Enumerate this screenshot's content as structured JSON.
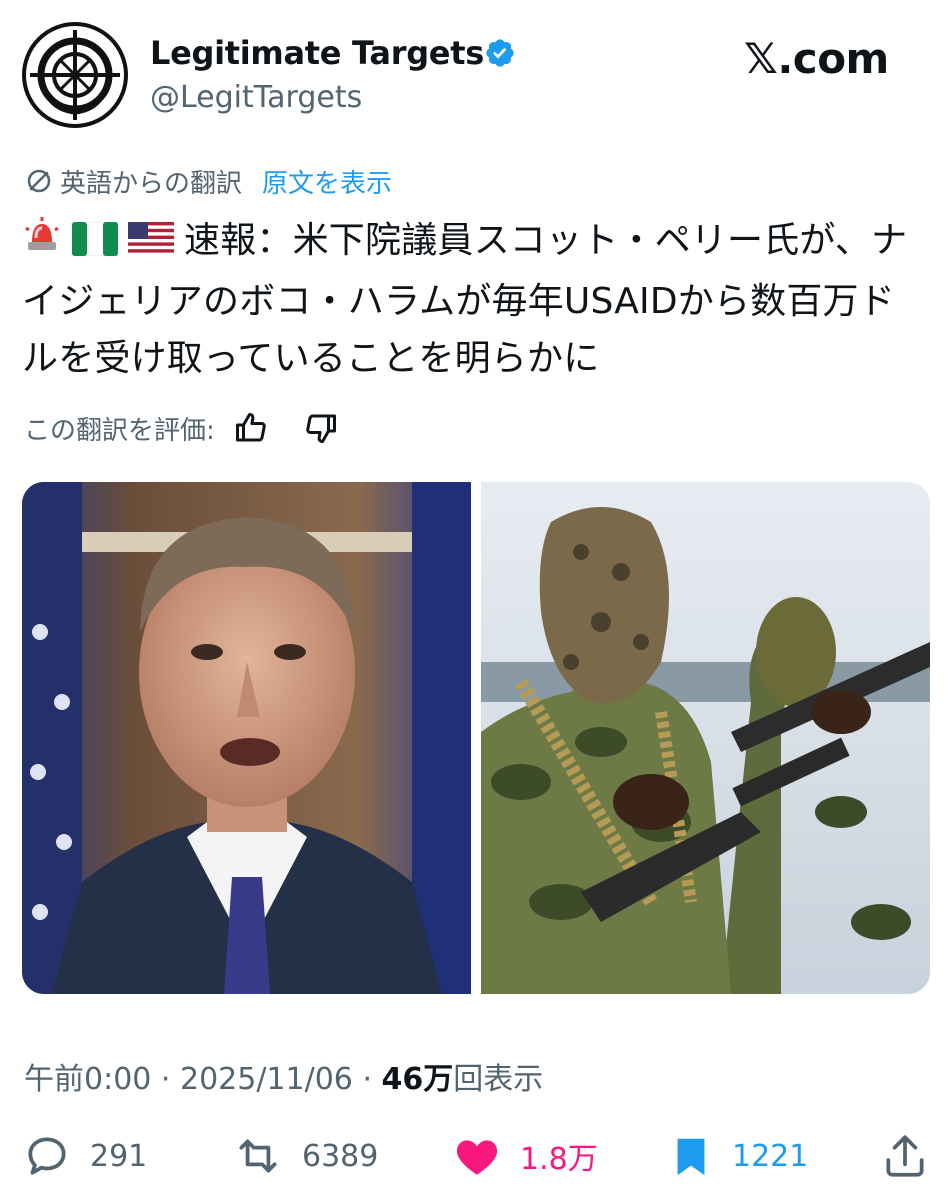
{
  "header": {
    "display_name": "Legitimate Targets",
    "handle": "@LegitTargets",
    "brand": "𝕏.com"
  },
  "translation": {
    "label": "英語からの翻訳",
    "show_original": "原文を表示"
  },
  "tweet": {
    "emojis": [
      "rotating-light-emoji",
      "nigeria-flag-emoji",
      "us-flag-emoji"
    ],
    "text": "速報：米下院議員スコット・ペリー氏が、ナイジェリアのボコ・ハラムが毎年USAIDから数百万ドルを受け取っていることを明らかに"
  },
  "rating": {
    "label": "この翻訳を評価:"
  },
  "meta": {
    "time": "午前0:00",
    "sep": " · ",
    "date": "2025/11/06",
    "views_count": "46万",
    "views_label": "回表示"
  },
  "actions": {
    "replies": "291",
    "reposts": "6389",
    "likes": "1.8万",
    "bookmarks": "1221"
  },
  "colors": {
    "accent": "#1d9bf0",
    "like": "#f91880",
    "muted": "#536471"
  }
}
